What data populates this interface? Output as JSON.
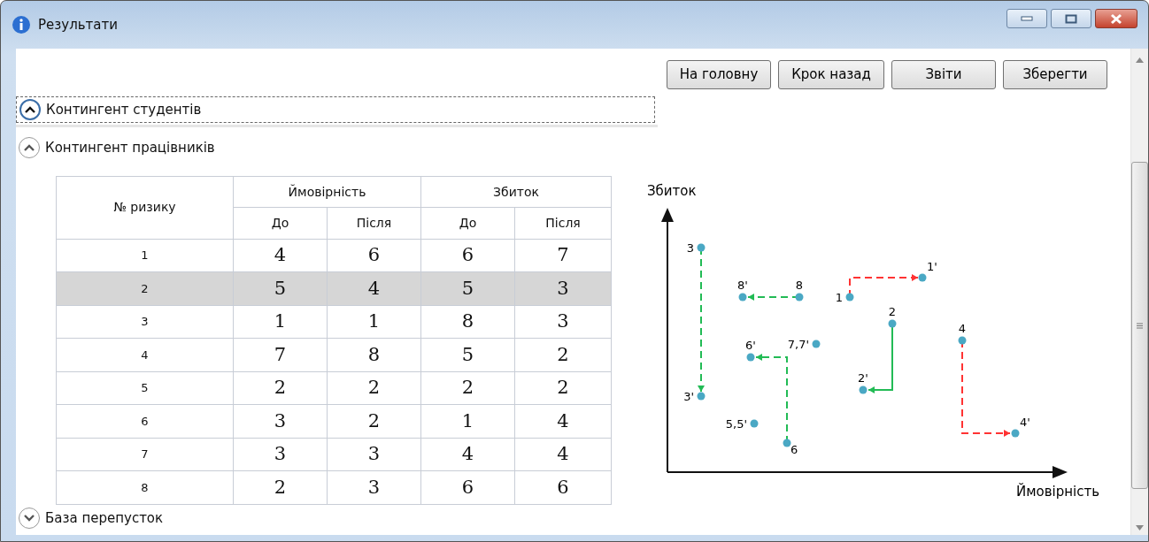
{
  "window": {
    "title": "Результати"
  },
  "buttons": [
    "На головну",
    "Крок назад",
    "Звіти",
    "Зберегти"
  ],
  "sections": [
    {
      "title": "Контингент студентів",
      "expanded": true,
      "focused": true
    },
    {
      "title": "Контингент працівників",
      "expanded": true,
      "focused": false
    },
    {
      "title": "База перепусток",
      "expanded": false,
      "focused": false
    }
  ],
  "table": {
    "first_column": "№ ризику",
    "groups": [
      "Ймовірність",
      "Збиток"
    ],
    "subcolumns": [
      "До",
      "Після",
      "До",
      "Після"
    ],
    "rows": [
      {
        "cells": [
          "1",
          "4",
          "6",
          "6",
          "7"
        ],
        "selected": false
      },
      {
        "cells": [
          "2",
          "5",
          "4",
          "5",
          "3"
        ],
        "selected": true
      },
      {
        "cells": [
          "3",
          "1",
          "1",
          "8",
          "3"
        ],
        "selected": false
      },
      {
        "cells": [
          "4",
          "7",
          "8",
          "5",
          "2"
        ],
        "selected": false
      },
      {
        "cells": [
          "5",
          "2",
          "2",
          "2",
          "2"
        ],
        "selected": false
      },
      {
        "cells": [
          "6",
          "3",
          "2",
          "1",
          "4"
        ],
        "selected": false
      },
      {
        "cells": [
          "7",
          "3",
          "3",
          "4",
          "4"
        ],
        "selected": false
      },
      {
        "cells": [
          "8",
          "2",
          "3",
          "6",
          "6"
        ],
        "selected": false
      }
    ]
  },
  "diagram": {
    "y_axis_label": "Збиток",
    "x_axis_label": "Ймовірність",
    "points": [
      {
        "label": "3"
      },
      {
        "label": "1'"
      },
      {
        "label": "8'"
      },
      {
        "label": "8"
      },
      {
        "label": "1"
      },
      {
        "label": "2"
      },
      {
        "label": "4"
      },
      {
        "label": "7,7'"
      },
      {
        "label": "6'"
      },
      {
        "label": "2'"
      },
      {
        "label": "3'"
      },
      {
        "label": "5,5'"
      },
      {
        "label": "4'"
      },
      {
        "label": "6"
      }
    ],
    "moves": [
      {
        "color": "#ff3333",
        "dashed": true
      },
      {
        "color": "#22bb55",
        "dashed": true
      },
      {
        "color": "#22bb55",
        "dashed": true
      },
      {
        "color": "#22bb55",
        "dashed": true
      },
      {
        "color": "#22bb55",
        "dashed": false
      },
      {
        "color": "#ff3333",
        "dashed": true
      }
    ]
  }
}
